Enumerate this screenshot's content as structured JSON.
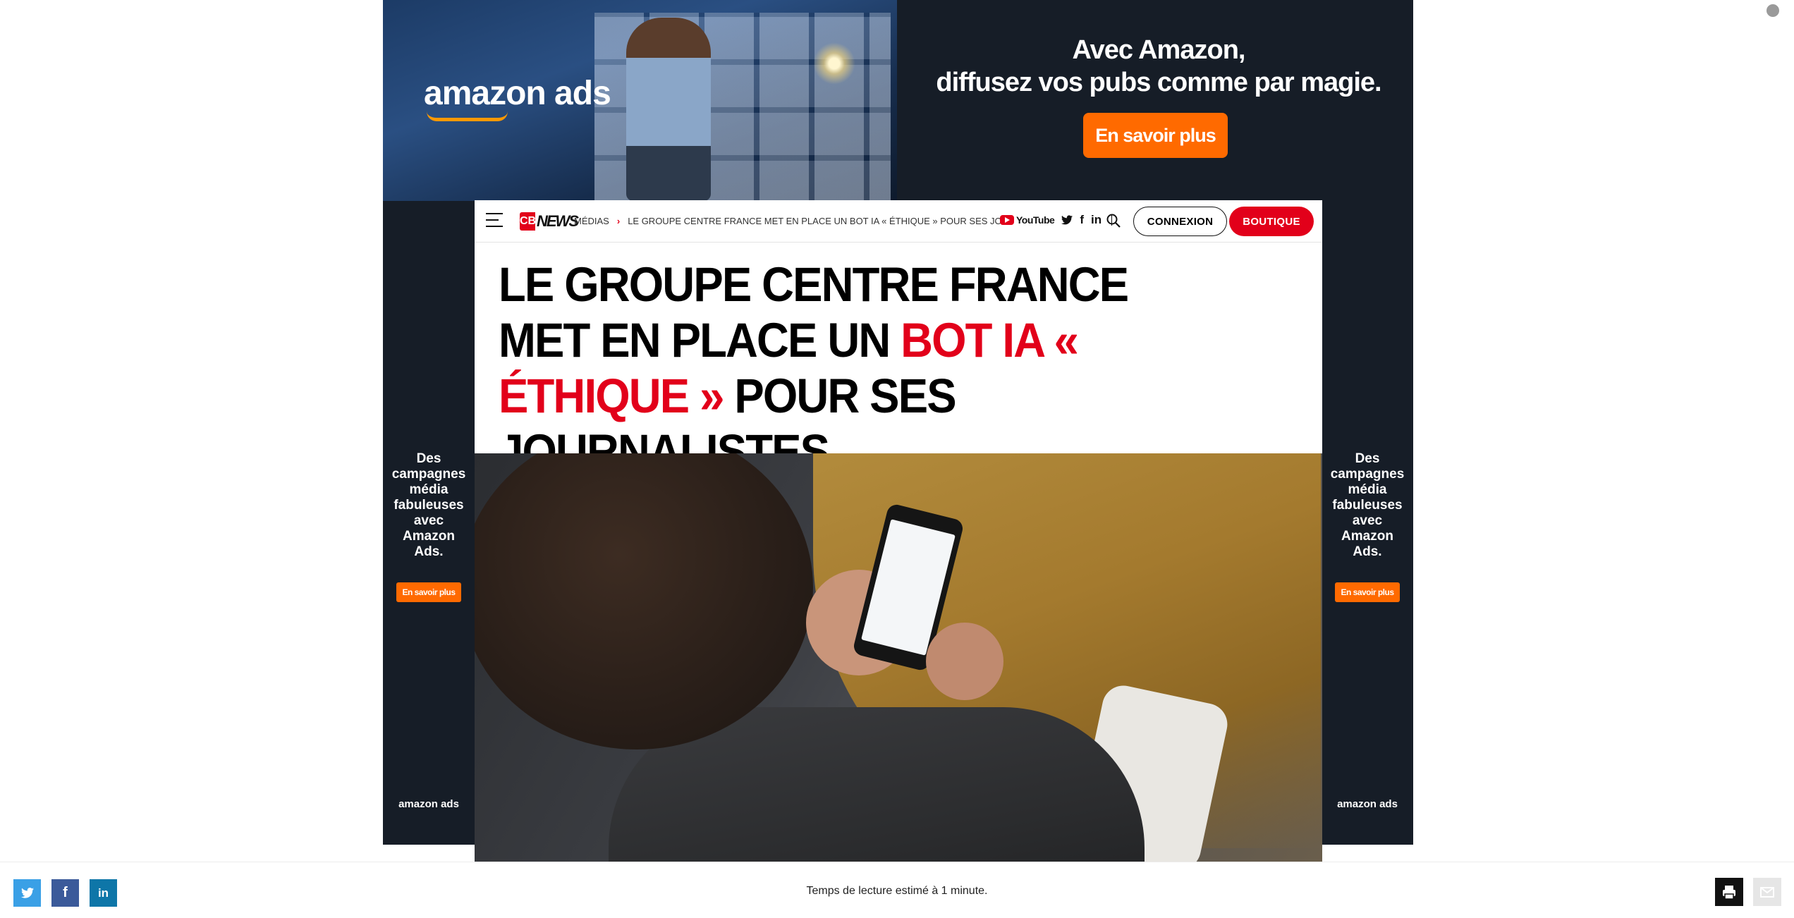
{
  "ad": {
    "logo": "amazon ads",
    "headline_line1": "Avec Amazon,",
    "headline_line2": "diffusez vos  pubs comme par magie.",
    "cta": "En savoir plus",
    "side_text": "Des campagnes média fabuleuses avec Amazon Ads.",
    "side_cta": "En savoir plus",
    "side_brand": "amazon ads",
    "colors": {
      "background": "#161d27",
      "cta": "#ff6a00",
      "smile": "#ff9900"
    }
  },
  "header": {
    "logo_mark": "CB",
    "logo_text": "NEWS",
    "breadcrumb": [
      "MÉDIAS",
      "LE GROUPE CENTRE FRANCE MET EN PLACE UN BOT IA « ÉTHIQUE » POUR SES JOURNALISTES"
    ],
    "youtube_label": "YouTube",
    "social_icons": [
      "youtube-icon",
      "twitter-icon",
      "facebook-icon",
      "linkedin-icon"
    ],
    "connexion_label": "CONNEXION",
    "boutique_label": "BOUTIQUE",
    "colors": {
      "brand_red": "#e2001a"
    }
  },
  "article": {
    "title_before": "LE GROUPE CENTRE FRANCE MET EN PLACE UN ",
    "title_highlight": "BOT IA « ÉTHIQUE »",
    "title_after": " POUR SES JOURNALISTES"
  },
  "footer": {
    "share_icons": [
      "twitter-icon",
      "facebook-icon",
      "linkedin-icon"
    ],
    "reading_time": "Temps de lecture estimé à 1 minute."
  }
}
